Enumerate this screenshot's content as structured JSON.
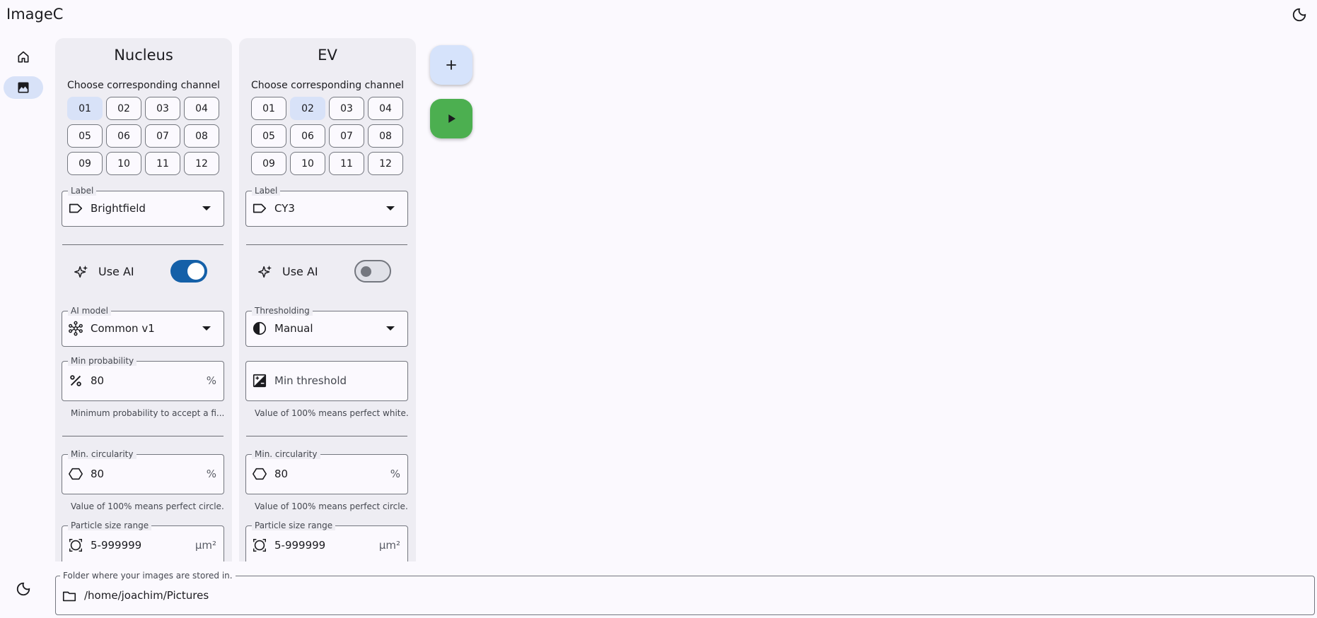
{
  "app": {
    "title": "ImageC"
  },
  "colors": {
    "accent": "#1460a8",
    "selected": "#d8e2f8",
    "run": "#4caf50",
    "background": "#fbf9fe",
    "panel": "#eeedf3"
  },
  "rail": {
    "items": [
      {
        "name": "home",
        "icon": "home-icon",
        "active": false
      },
      {
        "name": "images",
        "icon": "image-icon",
        "active": true
      }
    ],
    "bottom_icon": "moon-icon"
  },
  "top_right_icon": "moon-icon",
  "panels": [
    {
      "title": "Nucleus",
      "channel_prompt": "Choose corresponding channel",
      "channels": [
        "01",
        "02",
        "03",
        "04",
        "05",
        "06",
        "07",
        "08",
        "09",
        "10",
        "11",
        "12"
      ],
      "selected_channel": "01",
      "label_field": {
        "label": "Label",
        "value": "Brightfield"
      },
      "use_ai": {
        "label": "Use AI",
        "enabled": true
      },
      "second_select": {
        "label": "AI model",
        "value": "Common v1"
      },
      "third_field": {
        "label": "Min probability",
        "value": "80",
        "suffix": "%",
        "hint": "Minimum probability to accept a fi..."
      },
      "circularity": {
        "label": "Min. circularity",
        "value": "80",
        "suffix": "%",
        "hint": "Value of 100% means perfect circle."
      },
      "particle_size": {
        "label": "Particle size range",
        "value": "5-999999",
        "suffix": "µm²"
      }
    },
    {
      "title": "EV",
      "channel_prompt": "Choose corresponding channel",
      "channels": [
        "01",
        "02",
        "03",
        "04",
        "05",
        "06",
        "07",
        "08",
        "09",
        "10",
        "11",
        "12"
      ],
      "selected_channel": "02",
      "label_field": {
        "label": "Label",
        "value": "CY3"
      },
      "use_ai": {
        "label": "Use AI",
        "enabled": false
      },
      "second_select": {
        "label": "Thresholding",
        "value": "Manual"
      },
      "third_field": {
        "label": "",
        "placeholder": "Min threshold",
        "hint": "Value of 100% means perfect white."
      },
      "circularity": {
        "label": "Min. circularity",
        "value": "80",
        "suffix": "%",
        "hint": "Value of 100% means perfect circle."
      },
      "particle_size": {
        "label": "Particle size range",
        "value": "5-999999",
        "suffix": "µm²"
      }
    }
  ],
  "actions": {
    "add_icon": "plus-icon",
    "run_icon": "play-icon"
  },
  "folder": {
    "label": "Folder where your images are stored in.",
    "value": "/home/joachim/Pictures"
  }
}
